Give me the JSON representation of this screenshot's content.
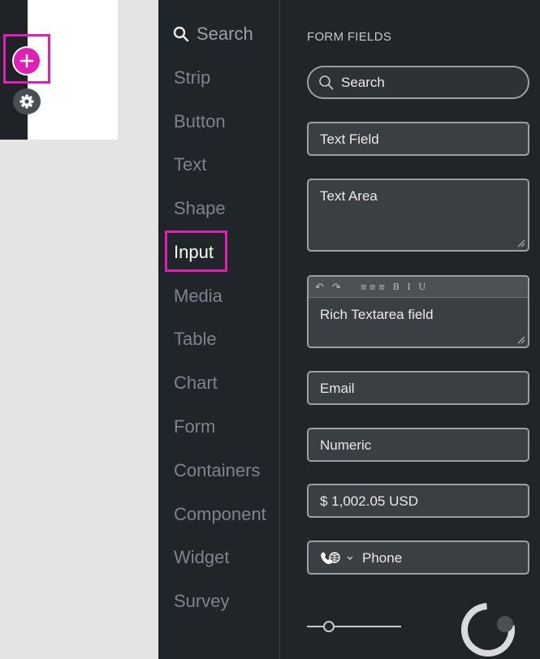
{
  "category_nav": {
    "search_label": "Search",
    "items": [
      "Strip",
      "Button",
      "Text",
      "Shape",
      "Input",
      "Media",
      "Table",
      "Chart",
      "Form",
      "Containers",
      "Component",
      "Widget",
      "Survey"
    ],
    "active_item": "Input"
  },
  "panel": {
    "title": "FORM FIELDS",
    "search_placeholder": "Search",
    "text_field": "Text Field",
    "text_area": "Text Area",
    "rich_textarea": "Rich Textarea field",
    "rich_toolbar_format": "B I U",
    "email": "Email",
    "numeric": "Numeric",
    "currency": "$ 1,002.05 USD",
    "phone": "Phone"
  },
  "colors": {
    "accent": "#e020b4",
    "panel_bg": "#20252a",
    "field_bg": "#3a3f44"
  },
  "icons": [
    "add-icon",
    "gear-icon",
    "search-icon",
    "undo-icon",
    "redo-icon",
    "align-icon",
    "phone-globe-icon",
    "chevron-down-icon",
    "resize-grip-icon"
  ],
  "slider_value_fraction": 0.23
}
